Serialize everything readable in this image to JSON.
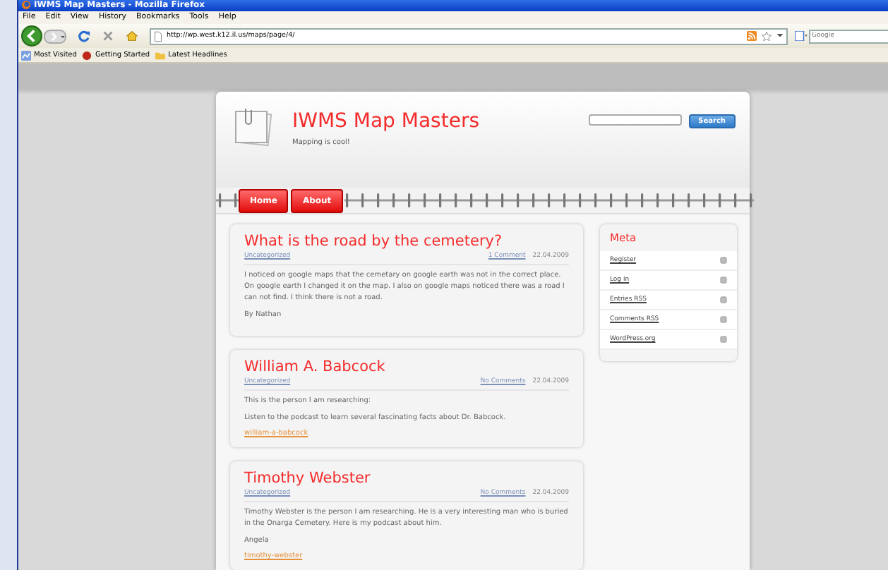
{
  "window": {
    "title": "IWMS Map Masters - Mozilla Firefox"
  },
  "menu": [
    "File",
    "Edit",
    "View",
    "History",
    "Bookmarks",
    "Tools",
    "Help"
  ],
  "address_bar": {
    "value": "http://wp.west.k12.il.us/maps/page/4/"
  },
  "search_bar": {
    "placeholder": "Google"
  },
  "bookmarks": [
    {
      "label": "Most Visited",
      "kind": "smart"
    },
    {
      "label": "Getting Started",
      "kind": "getting-started"
    },
    {
      "label": "Latest Headlines",
      "kind": "folder"
    }
  ],
  "site": {
    "title": "IWMS Map Masters",
    "tagline": "Mapping is cool!",
    "search_button": "Search"
  },
  "nav": [
    {
      "label": "Home"
    },
    {
      "label": "About"
    }
  ],
  "posts": [
    {
      "title": "What is the road by the cemetery?",
      "category": "Uncategorized",
      "comments": "1 Comment",
      "date": "22.04.2009",
      "paragraphs": [
        "I noticed on google maps  that the cemetary on google earth was not  in the correct place. On google earth I changed it on the map.  I also on google maps noticed there was a road I can not find. I think there is not a road.",
        "By Nathan"
      ]
    },
    {
      "title": "William A. Babcock",
      "category": "Uncategorized",
      "comments": "No Comments",
      "date": "22.04.2009",
      "paragraphs": [
        "This is the person I am researching:",
        "Listen to the podcast to learn several fascinating facts about Dr. Babcock."
      ],
      "tag": "william-a-babcock"
    },
    {
      "title": "Timothy Webster",
      "category": "Uncategorized",
      "comments": "No Comments",
      "date": "22.04.2009",
      "paragraphs": [
        "Timothy Webster is the person I am researching.  He is a very interesting man who is buried in the Onarga Cemetery. Here is my podcast about him.",
        "Angela"
      ],
      "tag": "timothy-webster"
    }
  ],
  "sidebar": {
    "title": "Meta",
    "items": [
      "Register",
      "Log in",
      "Entries RSS",
      "Comments RSS",
      "WordPress.org"
    ]
  }
}
